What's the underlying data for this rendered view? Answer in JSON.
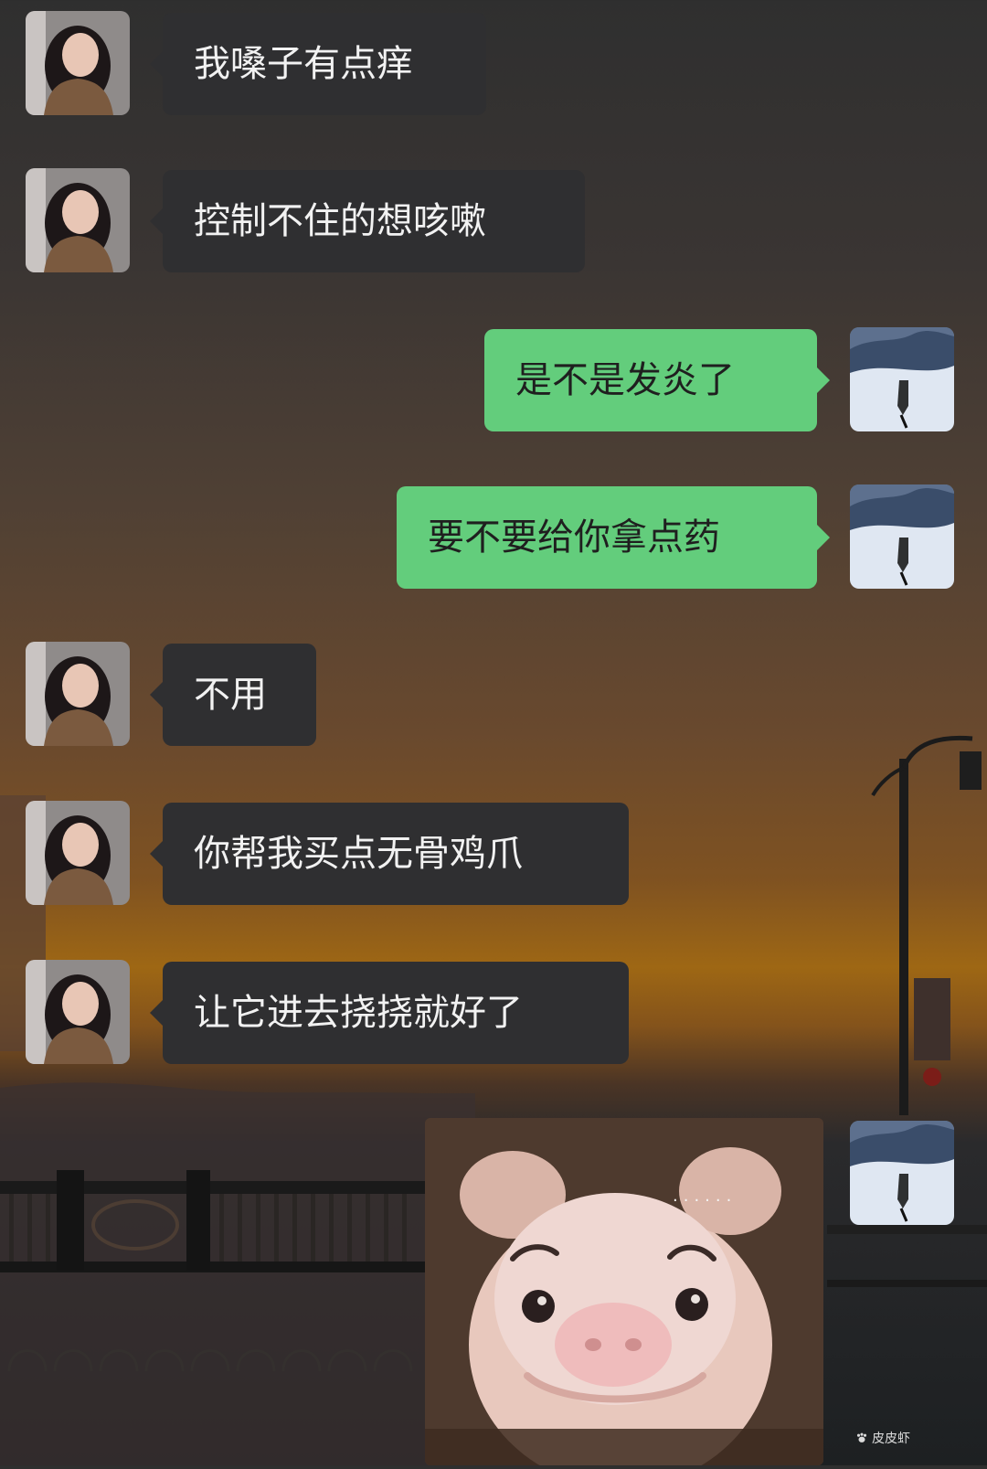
{
  "chat": {
    "messages": [
      {
        "side": "left",
        "text": "我嗓子有点痒"
      },
      {
        "side": "left",
        "text": "控制不住的想咳嗽"
      },
      {
        "side": "right",
        "text": "是不是发炎了"
      },
      {
        "side": "right",
        "text": "要不要给你拿点药"
      },
      {
        "side": "left",
        "text": "不用"
      },
      {
        "side": "left",
        "text": "你帮我买点无骨鸡爪"
      },
      {
        "side": "left",
        "text": "让它进去挠挠就好了"
      }
    ],
    "sticker": {
      "kind": "pig-face-sticker",
      "loading_dots": "......"
    }
  },
  "watermark": {
    "text": "皮皮虾",
    "icon": "paw-icon"
  },
  "colors": {
    "left_bubble": "#2f2f31",
    "right_bubble": "#63cd7c",
    "background_top": "#2f2f2f",
    "background_glow": "#9e6714"
  }
}
